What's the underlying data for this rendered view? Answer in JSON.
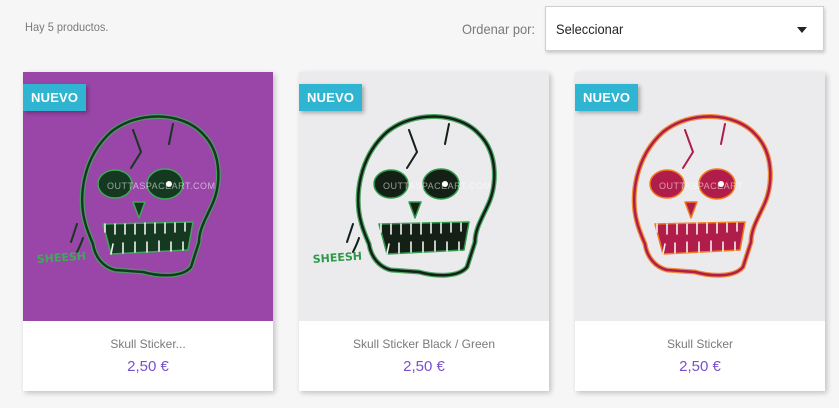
{
  "listing": {
    "count_text": "Hay 5 productos.",
    "sort_label": "Ordenar por:",
    "sort_value": "Seleccionar"
  },
  "products": [
    {
      "badge": "NUEVO",
      "name": "Skull Sticker...",
      "price": "2,50 €",
      "image_bg": "#9a46a8",
      "ink": "#153820",
      "glow": "#3fa85a",
      "caption": "SHEESH",
      "watermark": "OUTTASPACEART.COM"
    },
    {
      "badge": "NUEVO",
      "name": "Skull Sticker Black / Green",
      "price": "2,50 €",
      "image_bg": "#ebebed",
      "ink": "#142016",
      "glow": "#2f9a4a",
      "caption": "SHEESH",
      "watermark": "OUTTASPACEART.COM"
    },
    {
      "badge": "NUEVO",
      "name": "Skull Sticker",
      "price": "2,50 €",
      "image_bg": "#ebebed",
      "ink": "#b01d4a",
      "glow": "#f07a1c",
      "caption": "",
      "watermark": "OUTTASPACEART"
    }
  ],
  "colors": {
    "badge_bg": "#2fb5d2",
    "price": "#7a4fcf"
  }
}
